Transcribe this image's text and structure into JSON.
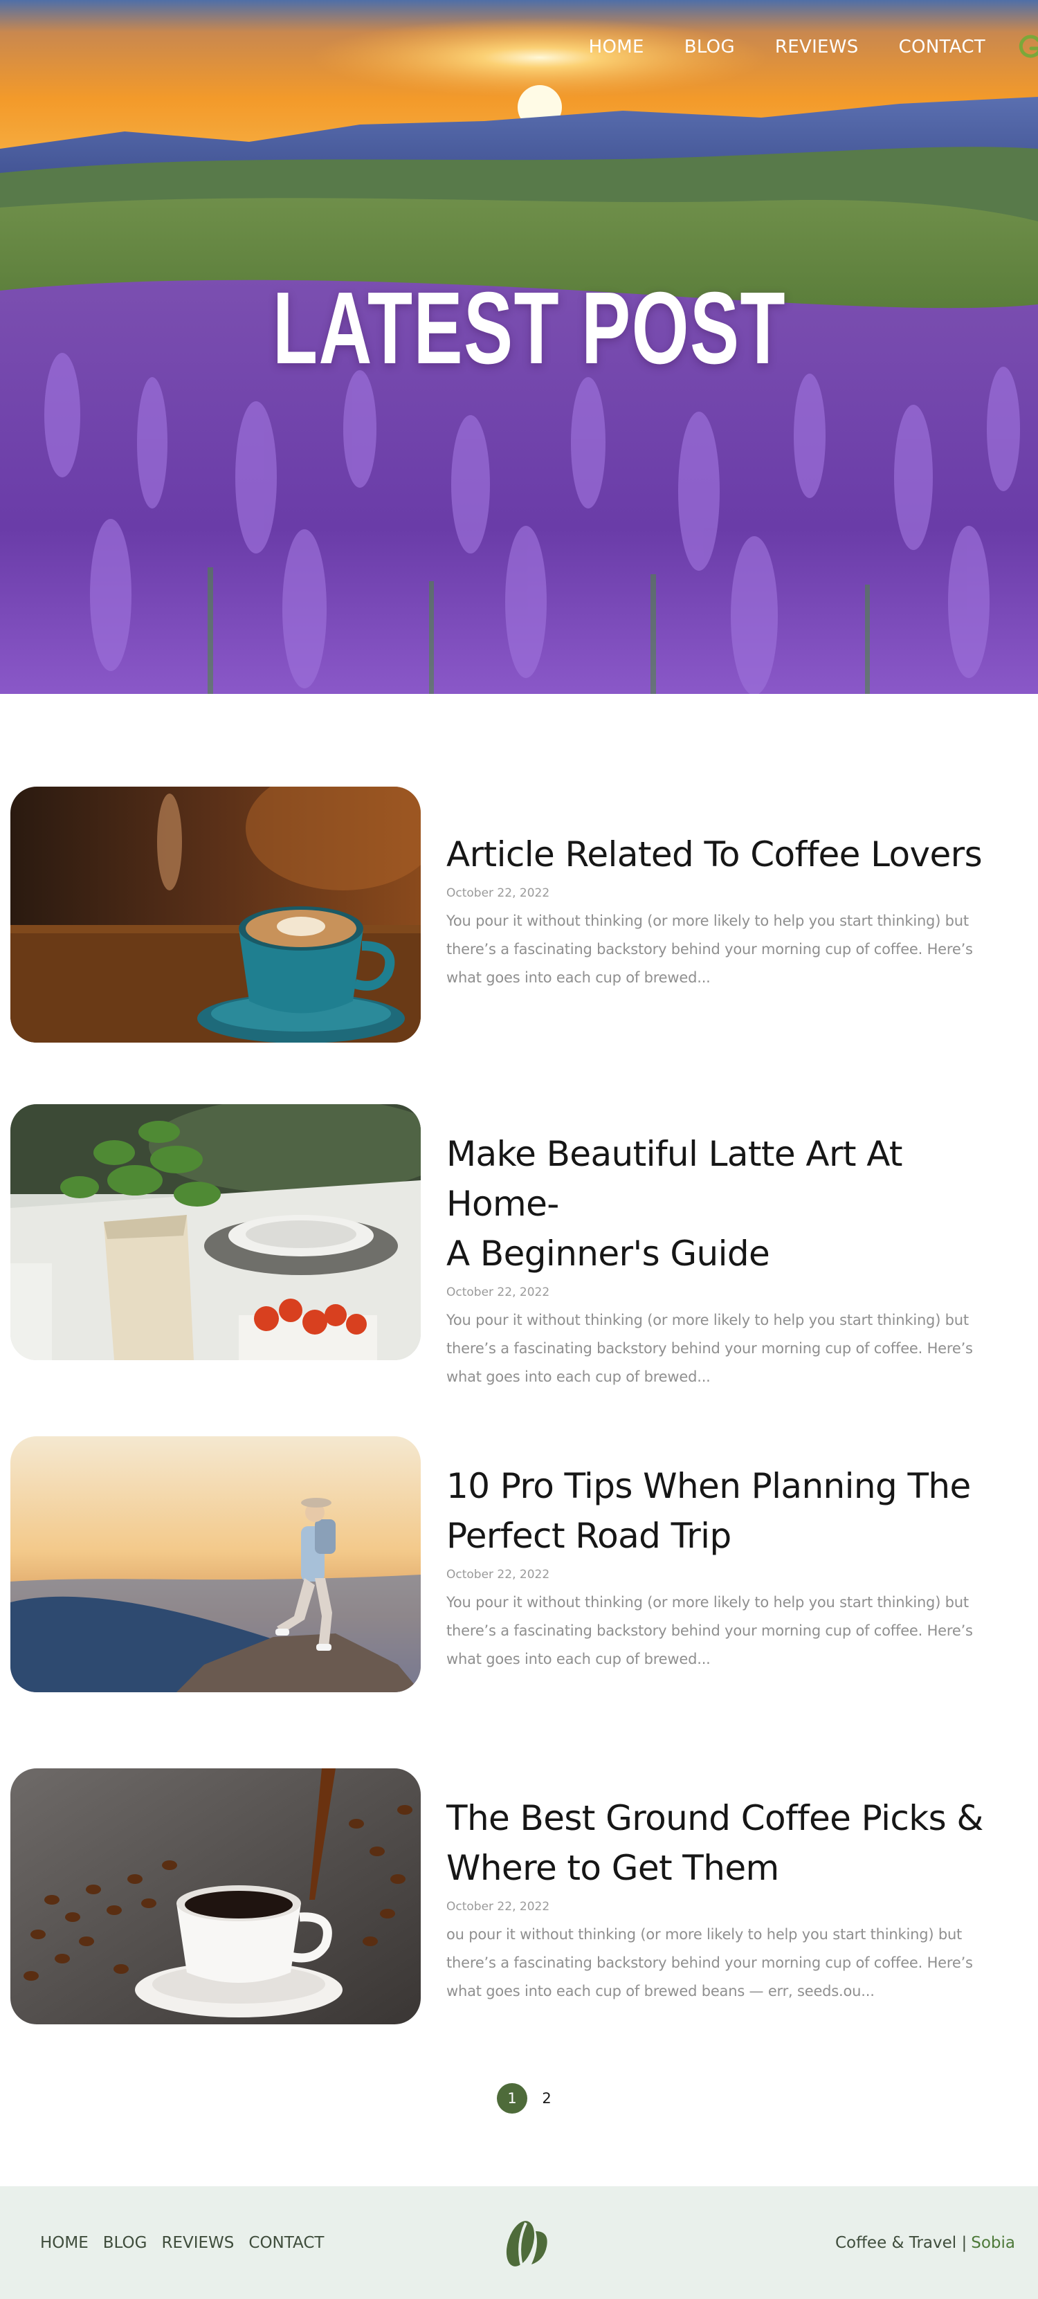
{
  "nav": {
    "items": [
      "HOME",
      "BLOG",
      "REVIEWS",
      "CONTACT"
    ],
    "brand_icon": "g-logo-icon"
  },
  "hero": {
    "title": "LATEST POST",
    "image": "lupine-field-sunset"
  },
  "posts": [
    {
      "title_lines": [
        "Article Related To Coffee Lovers"
      ],
      "date": "October 22, 2022",
      "excerpt_lines": [
        "You pour it without thinking (or more likely to help you start thinking) but",
        "there’s a fascinating backstory behind your morning cup of coffee. Here’s",
        "what goes into each cup of brewed..."
      ],
      "image": "latte-art-cup-photo"
    },
    {
      "title_lines": [
        "Make Beautiful Latte Art At Home-",
        "A Beginner's Guide"
      ],
      "date": "October 22, 2022",
      "excerpt_lines": [
        "You pour it without thinking (or more likely to help you start thinking) but",
        "there’s a fascinating backstory behind your morning cup of coffee. Here’s",
        "what goes into each cup of brewed..."
      ],
      "image": "table-with-basil-and-strawberries-photo"
    },
    {
      "title_lines": [
        "10 Pro Tips When Planning The",
        "Perfect Road Trip"
      ],
      "date": "October 22, 2022",
      "excerpt_lines": [
        "You pour it without thinking (or more likely to help you start thinking) but",
        "there’s a fascinating backstory behind your morning cup of coffee. Here’s",
        "what goes into each cup of brewed..."
      ],
      "image": "hiker-on-mountain-photo"
    },
    {
      "title_lines": [
        "The Best Ground Coffee Picks &",
        "Where to Get Them"
      ],
      "date": "October 22, 2022",
      "excerpt_lines": [
        "ou pour it without thinking (or more likely to help you start thinking) but",
        "there’s a fascinating backstory behind your morning cup of coffee. Here’s",
        "what goes into each cup of brewed beans — err, seeds.ou..."
      ],
      "image": "coffee-beans-and-cup-photo"
    }
  ],
  "pagination": {
    "pages": [
      "1",
      "2"
    ],
    "current": "1"
  },
  "footer": {
    "nav": [
      "HOME",
      "BLOG",
      "REVIEWS",
      "CONTACT"
    ],
    "logo": "coffee-bean-logo-icon",
    "credit_site": "Coffee & Travel |",
    "credit_author": "Sobia"
  },
  "colors": {
    "accent": "#4e6b3a",
    "footer_bg": "#e9f0eb",
    "muted_text": "#8f8f8f"
  }
}
